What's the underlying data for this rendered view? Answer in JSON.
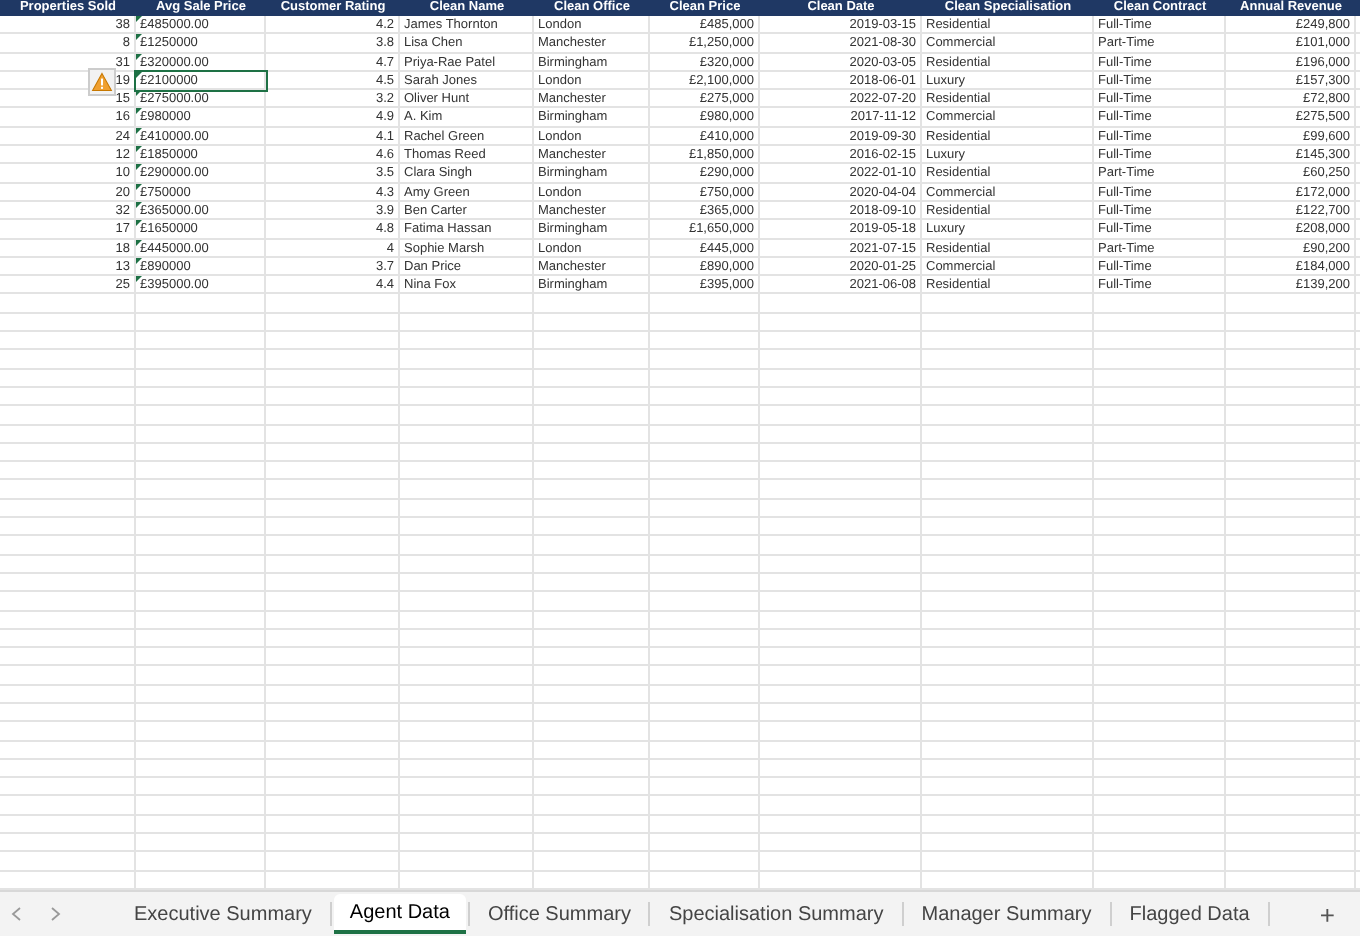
{
  "table": {
    "columns": [
      "Properties Sold",
      "Avg Sale Price",
      "Customer Rating",
      "Clean Name",
      "Clean Office",
      "Clean Price",
      "Clean Date",
      "Clean Specialisation",
      "Clean Contract",
      "Annual Revenue"
    ],
    "rows": [
      {
        "cells": [
          "38",
          "£485000.00",
          "4.2",
          "James Thornton",
          "London",
          "£485,000",
          "2019-03-15",
          "Residential",
          "Full-Time",
          "£249,800"
        ],
        "selected": false,
        "error_flag": true
      },
      {
        "cells": [
          "8",
          "£1250000",
          "3.8",
          "Lisa Chen",
          "Manchester",
          "£1,250,000",
          "2021-08-30",
          "Commercial",
          "Part-Time",
          "£101,000"
        ],
        "selected": false,
        "error_flag": true
      },
      {
        "cells": [
          "31",
          "£320000.00",
          "4.7",
          "Priya-Rae Patel",
          "Birmingham",
          "£320,000",
          "2020-03-05",
          "Residential",
          "Full-Time",
          "£196,000"
        ],
        "selected": false,
        "error_flag": true
      },
      {
        "cells": [
          "19",
          "£2100000",
          "4.5",
          "Sarah Jones",
          "London",
          "£2,100,000",
          "2018-06-01",
          "Luxury",
          "Full-Time",
          "£157,300"
        ],
        "selected": true,
        "error_flag": true
      },
      {
        "cells": [
          "15",
          "£275000.00",
          "3.2",
          "Oliver Hunt",
          "Manchester",
          "£275,000",
          "2022-07-20",
          "Residential",
          "Full-Time",
          "£72,800"
        ],
        "selected": false,
        "error_flag": true
      },
      {
        "cells": [
          "16",
          "£980000",
          "4.9",
          "A. Kim",
          "Birmingham",
          "£980,000",
          "2017-11-12",
          "Commercial",
          "Full-Time",
          "£275,500"
        ],
        "selected": false,
        "error_flag": true
      },
      {
        "cells": [
          "24",
          "£410000.00",
          "4.1",
          "Rachel Green",
          "London",
          "£410,000",
          "2019-09-30",
          "Residential",
          "Full-Time",
          "£99,600"
        ],
        "selected": false,
        "error_flag": true
      },
      {
        "cells": [
          "12",
          "£1850000",
          "4.6",
          "Thomas Reed",
          "Manchester",
          "£1,850,000",
          "2016-02-15",
          "Luxury",
          "Full-Time",
          "£145,300"
        ],
        "selected": false,
        "error_flag": true
      },
      {
        "cells": [
          "10",
          "£290000.00",
          "3.5",
          "Clara Singh",
          "Birmingham",
          "£290,000",
          "2022-01-10",
          "Residential",
          "Part-Time",
          "£60,250"
        ],
        "selected": false,
        "error_flag": true
      },
      {
        "cells": [
          "20",
          "£750000",
          "4.3",
          "Amy Green",
          "London",
          "£750,000",
          "2020-04-04",
          "Commercial",
          "Full-Time",
          "£172,000"
        ],
        "selected": false,
        "error_flag": true
      },
      {
        "cells": [
          "32",
          "£365000.00",
          "3.9",
          "Ben Carter",
          "Manchester",
          "£365,000",
          "2018-09-10",
          "Residential",
          "Full-Time",
          "£122,700"
        ],
        "selected": false,
        "error_flag": true
      },
      {
        "cells": [
          "17",
          "£1650000",
          "4.8",
          "Fatima Hassan",
          "Birmingham",
          "£1,650,000",
          "2019-05-18",
          "Luxury",
          "Full-Time",
          "£208,000"
        ],
        "selected": false,
        "error_flag": true
      },
      {
        "cells": [
          "18",
          "£445000.00",
          "4",
          "Sophie Marsh",
          "London",
          "£445,000",
          "2021-07-15",
          "Residential",
          "Part-Time",
          "£90,200"
        ],
        "selected": false,
        "error_flag": true
      },
      {
        "cells": [
          "13",
          "£890000",
          "3.7",
          "Dan Price",
          "Manchester",
          "£890,000",
          "2020-01-25",
          "Commercial",
          "Full-Time",
          "£184,000"
        ],
        "selected": false,
        "error_flag": true
      },
      {
        "cells": [
          "25",
          "£395000.00",
          "4.4",
          "Nina Fox",
          "Birmingham",
          "£395,000",
          "2021-06-08",
          "Residential",
          "Full-Time",
          "£139,200"
        ],
        "selected": false,
        "error_flag": true
      }
    ]
  },
  "sheet_tabs": [
    {
      "label": "Executive Summary",
      "selected": false
    },
    {
      "label": "Agent Data",
      "selected": true
    },
    {
      "label": "Office Summary",
      "selected": false
    },
    {
      "label": "Specialisation Summary",
      "selected": false
    },
    {
      "label": "Manager Summary",
      "selected": false
    },
    {
      "label": "Flagged Data",
      "selected": false
    }
  ],
  "add_sheet": "+"
}
